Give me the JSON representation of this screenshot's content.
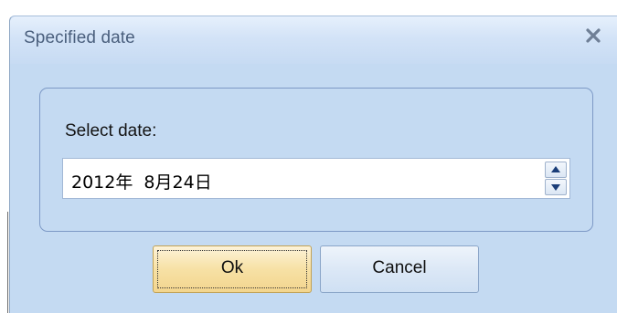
{
  "dialog": {
    "title": "Specified date",
    "close_icon": "close-icon",
    "group": {
      "label": "Select date:",
      "date_value": "2012年  8月24日",
      "spin_up_icon": "spin-up-arrow-icon",
      "spin_down_icon": "spin-down-arrow-icon"
    },
    "buttons": {
      "ok_label": "Ok",
      "cancel_label": "Cancel"
    }
  },
  "colors": {
    "dialog_background": "#c4daf2",
    "title_text": "#4a5f7d",
    "ok_button": "#f7e1a5",
    "cancel_button": "#dce8f6",
    "group_border": "#7d99c6"
  }
}
